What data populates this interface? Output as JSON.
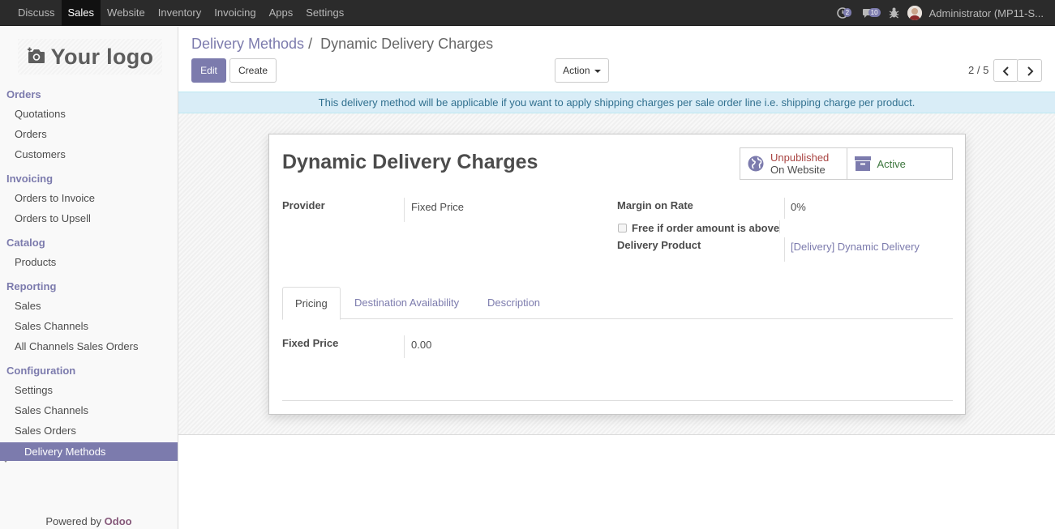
{
  "topbar": {
    "menu": [
      "Discuss",
      "Sales",
      "Website",
      "Inventory",
      "Invoicing",
      "Apps",
      "Settings"
    ],
    "active_menu": "Sales",
    "activity_count": "2",
    "messages_count": "10",
    "user_name": "Administrator (MP11-S..."
  },
  "sidebar": {
    "logo_text": "Your logo",
    "sections": {
      "orders": {
        "title": "Orders",
        "items": [
          "Quotations",
          "Orders",
          "Customers"
        ]
      },
      "invoicing": {
        "title": "Invoicing",
        "items": [
          "Orders to Invoice",
          "Orders to Upsell"
        ]
      },
      "catalog": {
        "title": "Catalog",
        "items": [
          "Products"
        ]
      },
      "reporting": {
        "title": "Reporting",
        "items": [
          "Sales",
          "Sales Channels",
          "All Channels Sales Orders"
        ]
      },
      "configuration": {
        "title": "Configuration",
        "items": [
          "Settings",
          "Sales Channels",
          "Sales Orders"
        ]
      }
    },
    "active_item": "Delivery Methods",
    "powered_by": "Powered by",
    "powered_brand": "Odoo"
  },
  "control_panel": {
    "breadcrumb_parent": "Delivery Methods",
    "breadcrumb_sep": "/",
    "breadcrumb_current": "Dynamic Delivery Charges",
    "edit_label": "Edit",
    "create_label": "Create",
    "action_label": "Action",
    "pager": "2 / 5"
  },
  "alert": "This delivery method will be applicable if you want to apply shipping charges per sale order line i.e. shipping charge per product.",
  "form": {
    "title": "Dynamic Delivery Charges",
    "website_status": "Unpublished",
    "website_sub": "On Website",
    "active_label": "Active",
    "provider_label": "Provider",
    "provider_value": "Fixed Price",
    "margin_label": "Margin on Rate",
    "margin_value": "0%",
    "free_label": "Free if order amount is above",
    "product_label": "Delivery Product",
    "product_value": "[Delivery] Dynamic Delivery",
    "tabs": [
      "Pricing",
      "Destination Availability",
      "Description"
    ],
    "fixed_price_label": "Fixed Price",
    "fixed_price_value": "0.00"
  },
  "colors": {
    "brand": "#7c7bad",
    "topbar": "#2b2b2b",
    "alert_bg": "#d9edf7",
    "unpublished": "#a94442",
    "active": "#3c763d"
  }
}
